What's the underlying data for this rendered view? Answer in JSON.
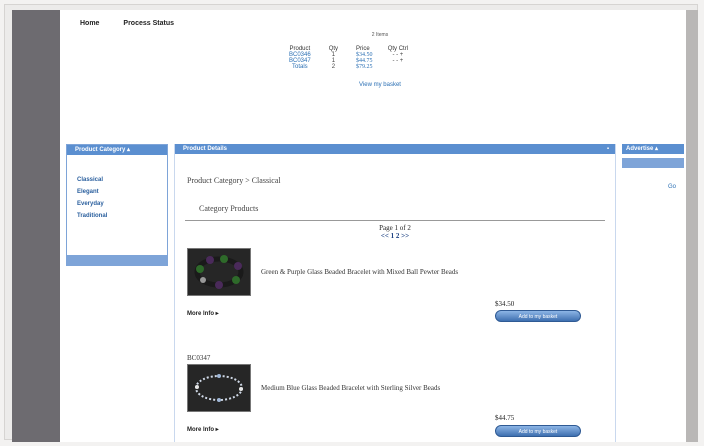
{
  "nav": {
    "home": "Home",
    "process_status": "Process Status"
  },
  "cart": {
    "item_count": "2 Items",
    "headers": [
      "Product",
      "Qty",
      "Price",
      "Qty Ctrl"
    ],
    "rows": [
      {
        "product": "BC0346",
        "qty": "1",
        "price": "$34.50",
        "ctrl": "- - +"
      },
      {
        "product": "BC0347",
        "qty": "1",
        "price": "$44.75",
        "ctrl": "- - +"
      }
    ],
    "totals": {
      "label": "Totals",
      "qty": "2",
      "price": "$79.25"
    },
    "view_basket": "View my basket"
  },
  "category_panel": {
    "title": "Product Category",
    "items": [
      "Classical",
      "Elegant",
      "Everyday",
      "Traditional"
    ]
  },
  "details_panel": {
    "title": "Product Details",
    "breadcrumb": "Product Category > Classical",
    "subheading": "Category Products",
    "pager": {
      "label": "Page 1 of 2",
      "nav": "<< 1 2 >>"
    },
    "products": [
      {
        "sku": "",
        "name": "Green & Purple Glass Beaded Bracelet with Mixed Ball Pewter Beads",
        "more_info": "More Info",
        "price": "$34.50",
        "add_button": "Add to my basket"
      },
      {
        "sku": "BC0347",
        "name": "Medium Blue Glass Beaded Bracelet with Sterling Silver Beads",
        "more_info": "More Info",
        "price": "$44.75",
        "add_button": "Add to my basket"
      }
    ]
  },
  "advertise_panel": {
    "title": "Advertise",
    "go": "Go"
  },
  "colors": {
    "panel_header": "#5b8fd0",
    "link": "#2a6fb4",
    "button": "#3e6fb0"
  }
}
